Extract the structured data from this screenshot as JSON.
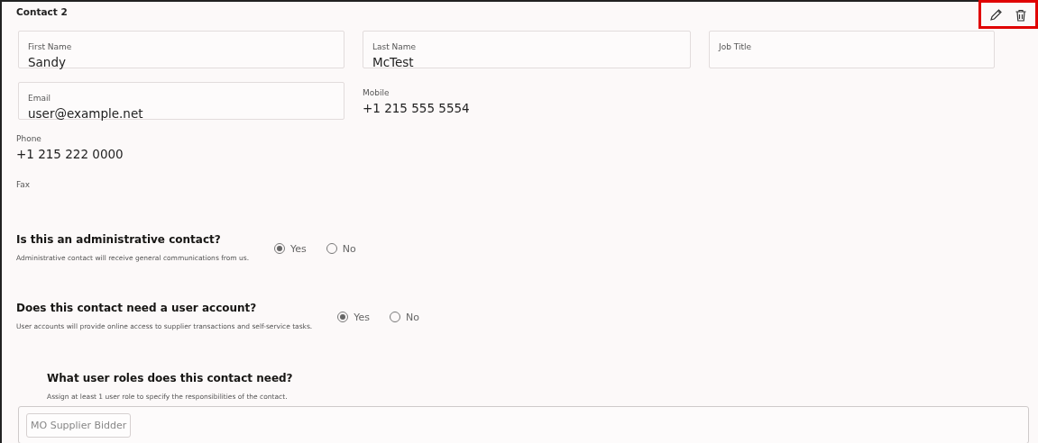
{
  "section": {
    "title": "Contact 2",
    "actions": [
      {
        "kind": "edit"
      },
      {
        "kind": "delete"
      }
    ],
    "actions_highlighted": true
  },
  "fields": [
    {
      "label": "First Name",
      "value": "Sandy",
      "boxed": true
    },
    {
      "label": "Last Name",
      "value": "McTest",
      "boxed": true
    },
    {
      "label": "Job Title",
      "boxed": true
    },
    {
      "label": "Email",
      "value": "user@example.net",
      "boxed": true
    },
    {
      "label": "Mobile",
      "value": "+1 215 555 5554",
      "boxed": false
    },
    {
      "label": "Phone",
      "value": "+1 215 222 0000",
      "boxed": false
    },
    {
      "label": "Fax",
      "boxed": false
    }
  ],
  "questions": [
    {
      "title": "Is this an administrative contact?",
      "help": "Administrative contact will receive general communications from us.",
      "options": [
        {
          "label": "Yes",
          "selected": true
        },
        {
          "label": "No",
          "selected": false
        }
      ]
    },
    {
      "title": "Does this contact need a user account?",
      "help": "User accounts will provide online access to supplier transactions and self-service tasks.",
      "options": [
        {
          "label": "Yes",
          "selected": true
        },
        {
          "label": "No",
          "selected": false
        }
      ]
    }
  ],
  "roles": {
    "title": "What user roles does this contact need?",
    "help": "Assign at least 1 user role to specify the responsibilities of the contact.",
    "chips": [
      "MO Supplier Bidder"
    ]
  }
}
